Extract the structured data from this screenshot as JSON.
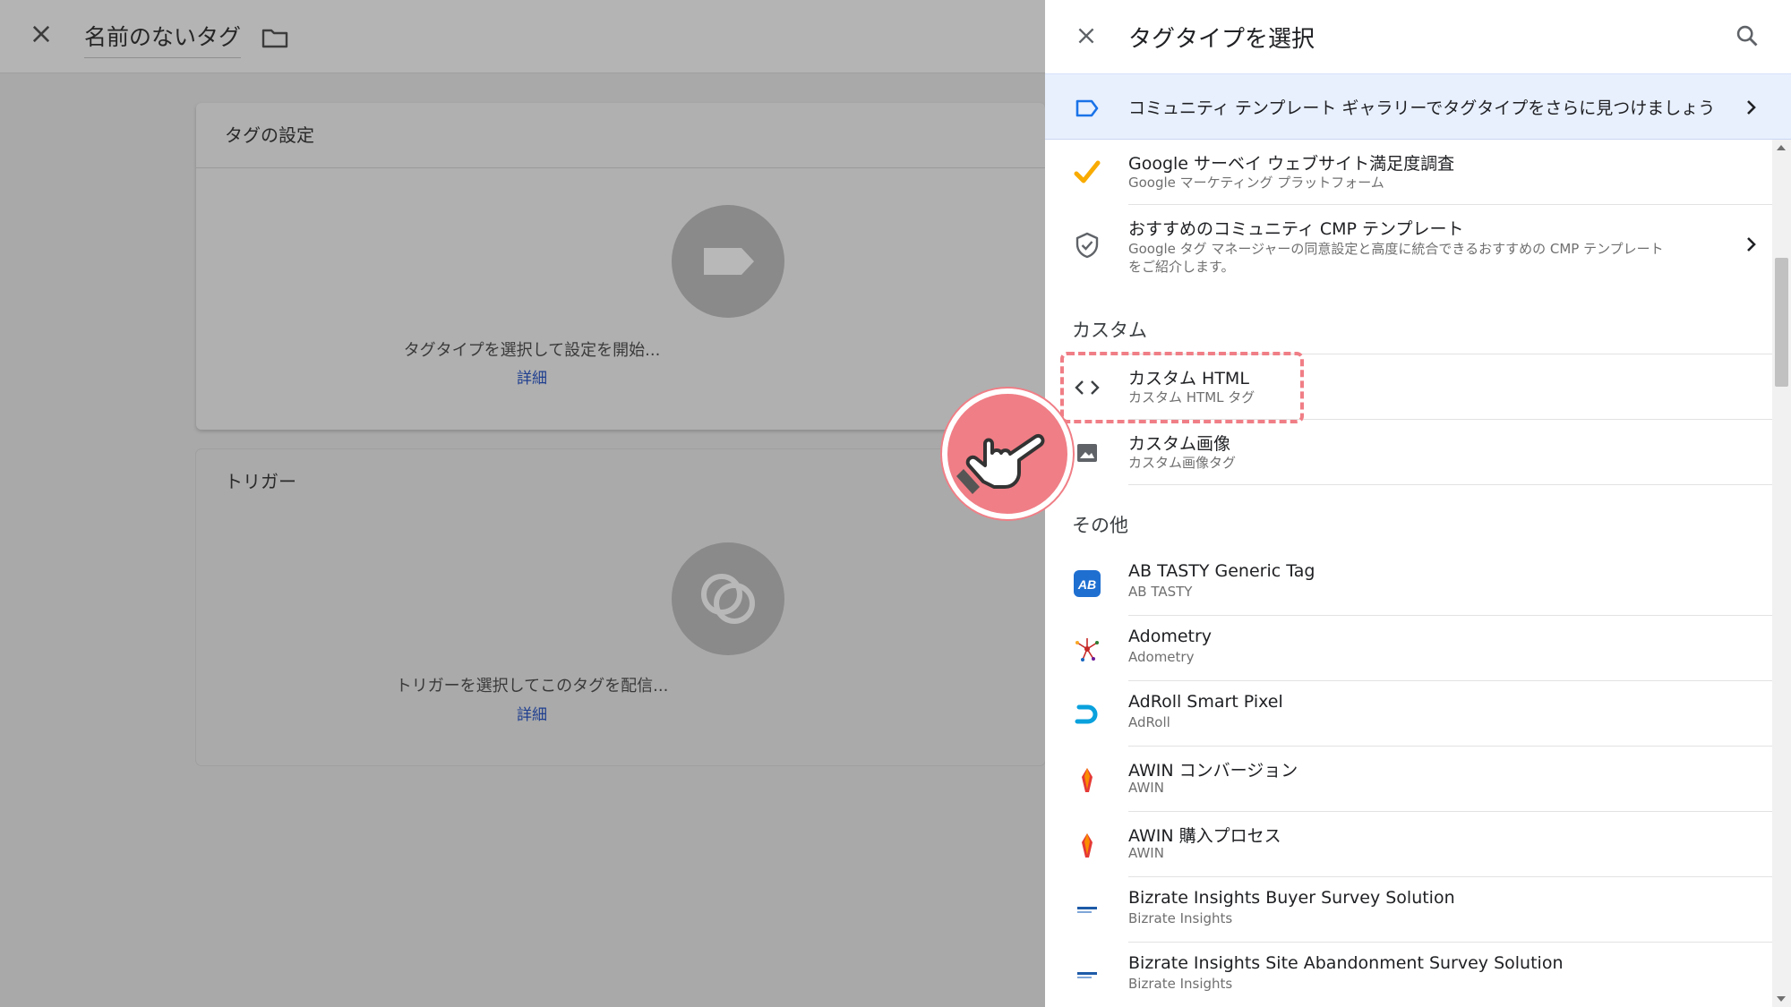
{
  "editor": {
    "title": "名前のないタグ",
    "tag_card": {
      "title": "タグの設定",
      "hint": "タグタイプを選択して設定を開始...",
      "more": "詳細"
    },
    "trigger_card": {
      "title": "トリガー",
      "hint": "トリガーを選択してこのタグを配信...",
      "more": "詳細"
    }
  },
  "panel": {
    "title": "タグタイプを選択",
    "banner": "コミュニティ テンプレート ギャラリーでタグタイプをさらに見つけましょう",
    "items_top": [
      {
        "name": "Google サーベイ ウェブサイト満足度調査",
        "sub": "Google マーケティング プラットフォーム",
        "icon": "check-icon"
      },
      {
        "name": "おすすめのコミュニティ CMP テンプレート",
        "sub": "Google タグ マネージャーの同意設定と高度に統合できるおすすめの CMP テンプレート",
        "sub2": "をご紹介します。",
        "icon": "shield-check-icon"
      }
    ],
    "section_custom": "カスタム",
    "items_custom": [
      {
        "name": "カスタム HTML",
        "sub": "カスタム HTML タグ",
        "icon": "code-icon"
      },
      {
        "name": "カスタム画像",
        "sub": "カスタム画像タグ",
        "icon": "image-icon"
      }
    ],
    "section_other": "その他",
    "items_other": [
      {
        "name": "AB TASTY Generic Tag",
        "sub": "AB TASTY",
        "icon": "ab-tasty-logo-icon"
      },
      {
        "name": "Adometry",
        "sub": "Adometry",
        "icon": "adometry-logo-icon"
      },
      {
        "name": "AdRoll Smart Pixel",
        "sub": "AdRoll",
        "icon": "adroll-logo-icon"
      },
      {
        "name": "AWIN コンバージョン",
        "sub": "AWIN",
        "icon": "awin-logo-icon"
      },
      {
        "name": "AWIN 購入プロセス",
        "sub": "AWIN",
        "icon": "awin-logo-icon"
      },
      {
        "name": "Bizrate Insights Buyer Survey Solution",
        "sub": "Bizrate Insights",
        "icon": "bizrate-logo-icon"
      },
      {
        "name": "Bizrate Insights Site Abandonment Survey Solution",
        "sub": "Bizrate Insights",
        "icon": "bizrate-logo-icon"
      }
    ]
  },
  "colors": {
    "accent": "#1a73e8",
    "highlight": "#f07e86",
    "banner_bg": "#e8f0fe"
  }
}
